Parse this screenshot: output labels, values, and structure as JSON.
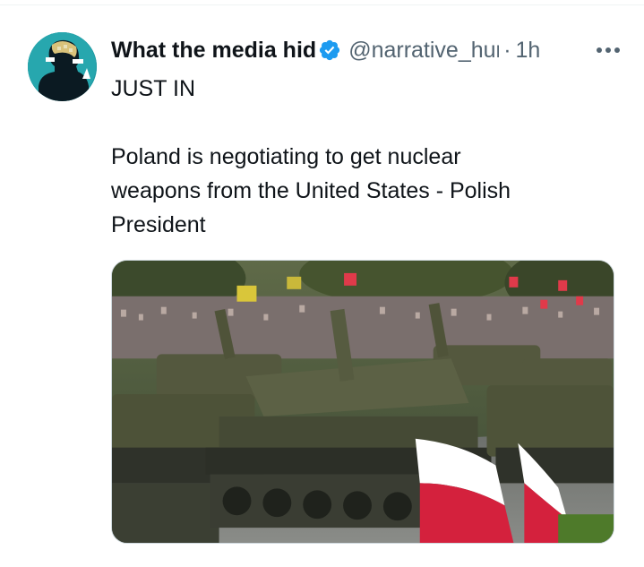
{
  "tweet": {
    "display_name": "What the media hid",
    "handle": "@narrative_hunter",
    "separator": "·",
    "time": "1h",
    "lines": [
      "JUST IN",
      "Poland is negotiating to get nuclear",
      "weapons from the United States - Polish",
      "President"
    ]
  },
  "icons": {
    "verified": "verified-badge-icon",
    "more": "more-options-icon"
  },
  "colors": {
    "verified_blue": "#1d9bf0",
    "text_primary": "#0f1419",
    "text_secondary": "#536471",
    "flag_red": "#d4213d",
    "flag_white": "#ffffff"
  }
}
